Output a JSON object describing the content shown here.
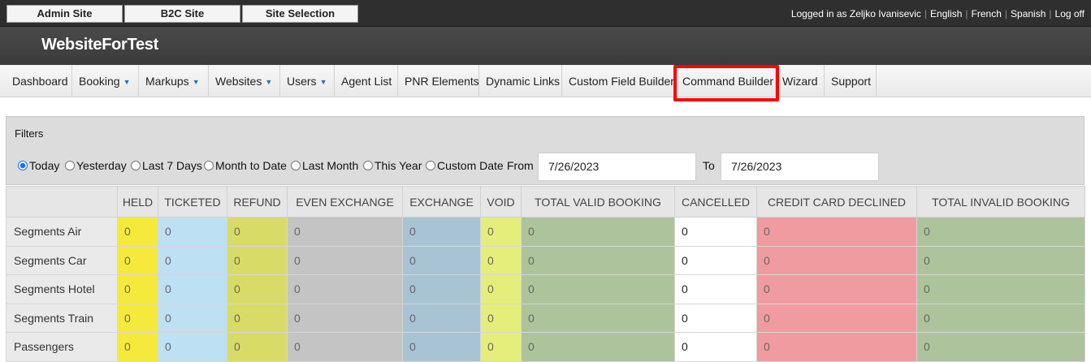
{
  "topbar": {
    "buttons": [
      "Admin Site",
      "B2C Site",
      "Site Selection"
    ],
    "logged_in_text": "Logged in as Zeljko Ivanisevic",
    "languages": [
      "English",
      "French",
      "Spanish"
    ],
    "logoff": "Log off"
  },
  "brand": {
    "title": "WebsiteForTest"
  },
  "nav": {
    "items": [
      {
        "label": "Dashboard"
      },
      {
        "label": "Booking",
        "dropdown": true
      },
      {
        "label": "Markups",
        "dropdown": true
      },
      {
        "label": "Websites",
        "dropdown": true
      },
      {
        "label": "Users",
        "dropdown": true
      },
      {
        "label": "Agent List"
      },
      {
        "label": "PNR Elements"
      },
      {
        "label": "Dynamic Links"
      },
      {
        "label": "Custom Field Builder"
      },
      {
        "label": "Command Builder",
        "highlighted": true
      },
      {
        "label": "Wizard"
      },
      {
        "label": "Support"
      }
    ],
    "highlight_color": "#ff0000"
  },
  "filters": {
    "title": "Filters",
    "options": [
      "Today",
      "Yesterday",
      "Last 7 Days",
      "Month to Date",
      "Last Month",
      "This Year",
      "Custom Date"
    ],
    "selected": "Today",
    "from_label": "From",
    "from_value": "7/26/2023",
    "to_label": "To",
    "to_value": "7/26/2023"
  },
  "table": {
    "columns": [
      "HELD",
      "TICKETED",
      "REFUND",
      "EVEN EXCHANGE",
      "EXCHANGE",
      "VOID",
      "TOTAL VALID BOOKING",
      "CANCELLED",
      "CREDIT CARD DECLINED",
      "TOTAL INVALID BOOKING"
    ],
    "column_colors": [
      "#f5ea3c",
      "#bde0f3",
      "#d8dc66",
      "#c4c4c4",
      "#a8c3d4",
      "#e5ee7a",
      "#adc39c",
      "#ffffff",
      "#f09ba0",
      "#adc39c"
    ],
    "rows": [
      {
        "label": "Segments Air",
        "values": [
          "0",
          "0",
          "0",
          "0",
          "0",
          "0",
          "0",
          "0",
          "0",
          "0"
        ]
      },
      {
        "label": "Segments Car",
        "values": [
          "0",
          "0",
          "0",
          "0",
          "0",
          "0",
          "0",
          "0",
          "0",
          "0"
        ]
      },
      {
        "label": "Segments Hotel",
        "values": [
          "0",
          "0",
          "0",
          "0",
          "0",
          "0",
          "0",
          "0",
          "0",
          "0"
        ]
      },
      {
        "label": "Segments Train",
        "values": [
          "0",
          "0",
          "0",
          "0",
          "0",
          "0",
          "0",
          "0",
          "0",
          "0"
        ]
      },
      {
        "label": "Passengers",
        "values": [
          "0",
          "0",
          "0",
          "0",
          "0",
          "0",
          "0",
          "0",
          "0",
          "0"
        ]
      }
    ]
  }
}
